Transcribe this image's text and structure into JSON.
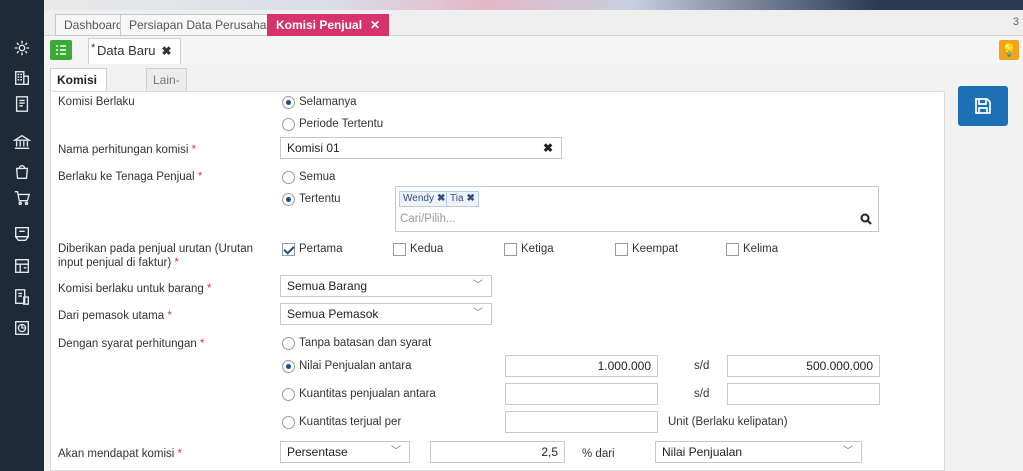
{
  "tabs": {
    "dashboard": "Dashboard",
    "company_setup": "Persiapan Data Perusahaan",
    "active": "Komisi Penjual",
    "count": "3"
  },
  "doc_tab": {
    "label": "Data Baru",
    "modified_mark": "*"
  },
  "inner_tabs": {
    "commission": "Komisi Penjual",
    "other": "Lain-lain"
  },
  "form": {
    "berlaku": {
      "label": "Komisi Berlaku",
      "opt_forever": "Selamanya",
      "opt_period": "Periode Tertentu",
      "selected": "Selamanya"
    },
    "nama": {
      "label": "Nama perhitungan komisi",
      "value": "Komisi 01"
    },
    "tenaga": {
      "label": "Berlaku ke Tenaga Penjual",
      "opt_all": "Semua",
      "opt_specific": "Tertentu",
      "selected": "Tertentu",
      "tags": [
        "Wendy",
        "Tia"
      ],
      "placeholder": "Cari/Pilih..."
    },
    "urutan": {
      "label_1": "Diberikan pada penjual urutan (Urutan",
      "label_2": "input penjual di faktur)",
      "options": [
        "Pertama",
        "Kedua",
        "Ketiga",
        "Keempat",
        "Kelima"
      ],
      "checked": [
        "Pertama"
      ]
    },
    "barang": {
      "label": "Komisi berlaku untuk barang",
      "value": "Semua Barang"
    },
    "pemasok": {
      "label": "Dari pemasok utama",
      "value": "Semua Pemasok"
    },
    "syarat": {
      "label": "Dengan syarat perhitungan",
      "opt_none": "Tanpa batasan dan syarat",
      "opt_sales": "Nilai Penjualan antara",
      "opt_qty": "Kuantitas penjualan antara",
      "opt_sold": "Kuantitas terjual per",
      "selected": "Nilai Penjualan antara",
      "sales_from": "1.000.000",
      "sales_to": "500.000.000",
      "sd": "s/d",
      "unit_note": "Unit (Berlaku kelipatan)"
    },
    "mendapat": {
      "label": "Akan mendapat komisi",
      "type": "Persentase",
      "value": "2,5",
      "pct_of": "% dari",
      "basis": "Nilai Penjualan"
    }
  },
  "required_mark": "*",
  "colors": {
    "accent": "#d6336c",
    "sidebar": "#1f2a38",
    "save": "#1b6fb5",
    "list": "#3aa935",
    "bulb": "#f3a31b"
  }
}
